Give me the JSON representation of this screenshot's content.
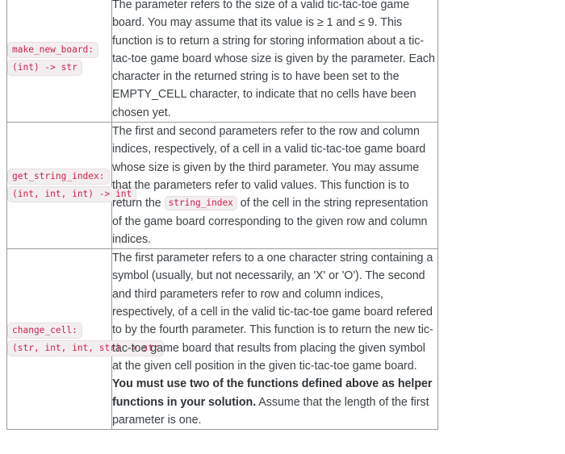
{
  "document": {
    "type": "function-specification-table",
    "accent_code_color": "#c7254e",
    "chip_background": "#f3eff0",
    "text_color": "#3c4246",
    "border_color": "#9a9a9a"
  },
  "table": {
    "rows": [
      {
        "signature": {
          "name": "make_new_board:",
          "types": "(int) -> str"
        },
        "description": {
          "segments": [
            {
              "kind": "text",
              "text": "The parameter refers to the size of a valid tic-tac-toe game board. You may assume that its value is ≥ 1 and ≤ 9. This function is to return a string for storing information about a tic-tac-toe game board whose size is given by the parameter. Each character in the returned string is to have been set to the EMPTY_CELL character, to indicate that no cells have been chosen yet."
            }
          ]
        }
      },
      {
        "signature": {
          "name": "get_string_index:",
          "types": "(int, int, int) -> int"
        },
        "description": {
          "segments": [
            {
              "kind": "text",
              "text": "The first and second parameters refer to the row and column indices, respectively, of a cell in a valid tic-tac-toe game board whose size is given by the third parameter. You may assume that the parameters refer to valid values. This function is to return the "
            },
            {
              "kind": "code",
              "text": "string_index"
            },
            {
              "kind": "text",
              "text": " of the cell in the string representation of the game board corresponding to the given row and column indices."
            }
          ]
        }
      },
      {
        "signature": {
          "name": "change_cell:",
          "types": "(str, int, int, str) -> str"
        },
        "description": {
          "segments": [
            {
              "kind": "text",
              "text": "The first parameter refers to a one character string containing a symbol (usually, but not necessarily, an 'X' or 'O'). The second and third parameters refer to row and column indices, respectively, of a cell in the valid tic-tac-toe game board refered to by the fourth parameter. This function is to return the new tic-tac-toe game board that results from placing the given symbol at the given cell position in the given tic-tac-toe game board.  "
            },
            {
              "kind": "bold",
              "text": "You must use two of the functions defined above as helper functions in your solution."
            },
            {
              "kind": "text",
              "text": "  Assume that the length of the first parameter is one."
            }
          ]
        }
      }
    ]
  }
}
